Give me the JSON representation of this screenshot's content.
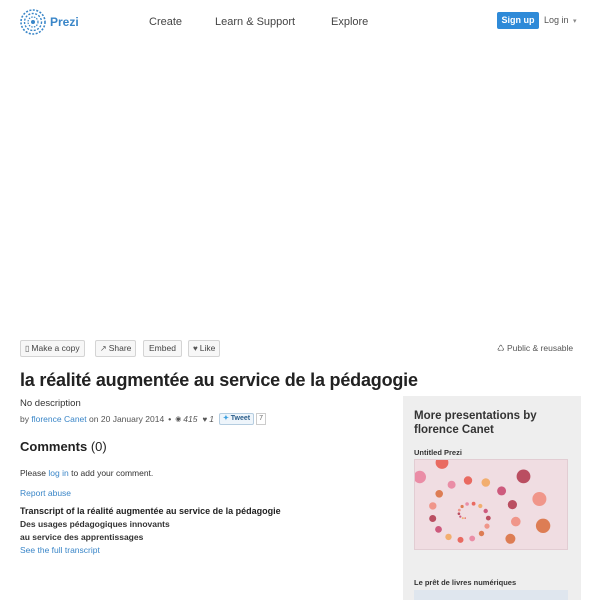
{
  "header": {
    "brand": "Prezi",
    "nav": [
      "Create",
      "Learn & Support",
      "Explore"
    ],
    "signup": "Sign up",
    "login": "Log in"
  },
  "toolbar": {
    "make_copy": "Make a copy",
    "share": "Share",
    "embed": "Embed",
    "like": "Like",
    "license": "Public & reusable"
  },
  "presentation": {
    "title": "la réalité augmentée au service de la pédagogie",
    "description": "No description",
    "by": "by",
    "author": "florence Canet",
    "date_prefix": "on",
    "date": "20 January 2014",
    "views": "415",
    "likes": "1",
    "tweet": "Tweet",
    "tweet_count": "7"
  },
  "comments": {
    "heading": "Comments",
    "count": "(0)",
    "please": "Please",
    "login_link": "log in",
    "suffix": "to add your comment.",
    "report": "Report abuse"
  },
  "transcript": {
    "title": "Transcript of la réalité augmentée au service de la pédagogie",
    "lines": [
      "Des usages pédagogiques innovants",
      "au service des apprentissages"
    ],
    "full_link": "See the full transcript"
  },
  "sidebar": {
    "heading_line1": "More presentations by",
    "heading_line2": "florence Canet",
    "items": [
      {
        "title": "Untitled Prezi"
      },
      {
        "title": "Le prêt de livres numériques"
      }
    ]
  },
  "colors": {
    "accent": "#3a86c8",
    "signup_bg": "#2e8ad8",
    "sidebar_bg": "#eeeeee",
    "thumb_bg": "#f0dde2"
  }
}
